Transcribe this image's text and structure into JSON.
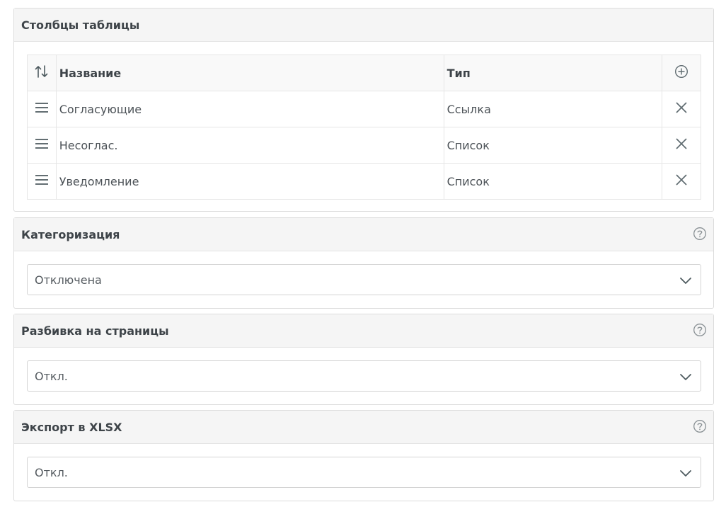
{
  "columns_panel": {
    "title": "Столбцы таблицы",
    "header": {
      "sort_icon": "sort-arrows-icon",
      "name": "Название",
      "type": "Тип",
      "add_icon": "plus-circle-icon"
    },
    "rows": [
      {
        "name": "Согласующие",
        "type": "Ссылка"
      },
      {
        "name": "Несоглас.",
        "type": "Список"
      },
      {
        "name": "Уведомление",
        "type": "Список"
      }
    ]
  },
  "categorization": {
    "title": "Категоризация",
    "value": "Отключена",
    "help_icon": "question-circle-icon"
  },
  "pagination": {
    "title": "Разбивка на страницы",
    "value": "Откл.",
    "help_icon": "question-circle-icon"
  },
  "export": {
    "title": "Экспорт в XLSX",
    "value": "Откл.",
    "help_icon": "question-circle-icon"
  },
  "colors": {
    "header_bg": "#f5f5f5",
    "border": "#dcdcdc",
    "text": "#444a4f",
    "icon": "#5f6b70"
  }
}
